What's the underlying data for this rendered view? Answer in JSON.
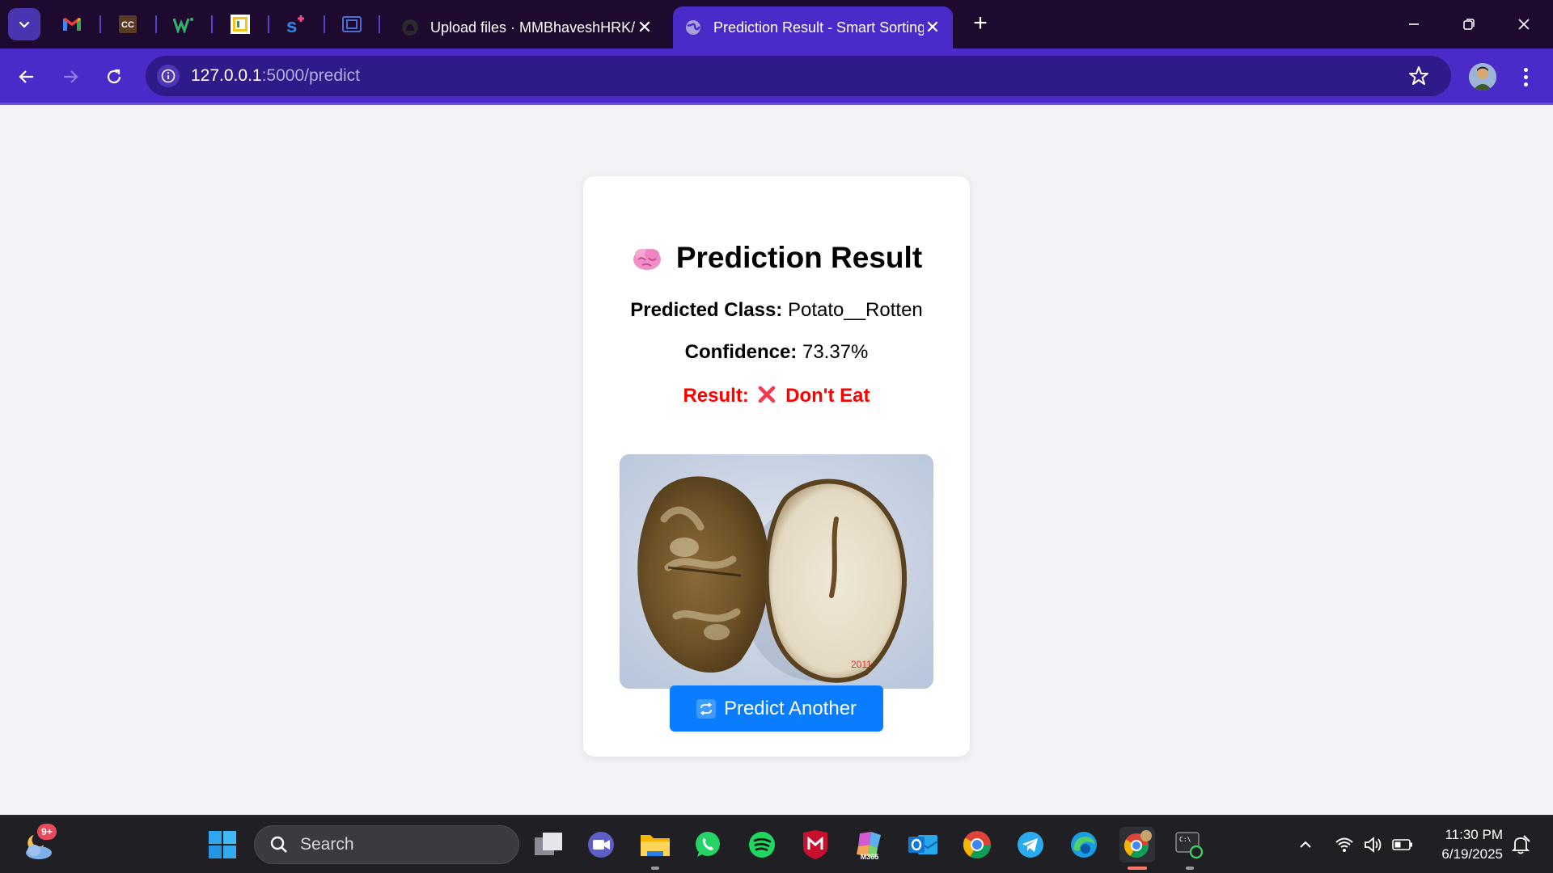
{
  "browser": {
    "tabs": [
      {
        "title": "Upload files · MMBhaveshHRK/",
        "active": false
      },
      {
        "title": "Prediction Result - Smart Sorting",
        "active": true
      }
    ],
    "pinned_tabs": [
      "gmail-icon",
      "cc-icon",
      "w-icon",
      "spreadsheet-icon",
      "s-plus-icon",
      "window-icon"
    ],
    "address": {
      "host": "127.0.0.1",
      "path": ":5000/predict"
    }
  },
  "page": {
    "title": "Prediction Result",
    "predicted_class": {
      "label": "Predicted Class:",
      "value": "Potato__Rotten"
    },
    "confidence": {
      "label": "Confidence:",
      "value": "73.37%"
    },
    "result": {
      "label": "Result:",
      "value": "Don't Eat"
    },
    "photo_stamp": "2011",
    "button": "Predict Another",
    "colors": {
      "result": "#ff0000",
      "button": "#0a7cff",
      "tab_active": "#4a2bc9",
      "toolbar": "#4a2bc9"
    }
  },
  "taskbar": {
    "weather_badge": "9+",
    "search_placeholder": "Search",
    "m365_label": "M365",
    "time": "11:30 PM",
    "date": "6/19/2025"
  }
}
